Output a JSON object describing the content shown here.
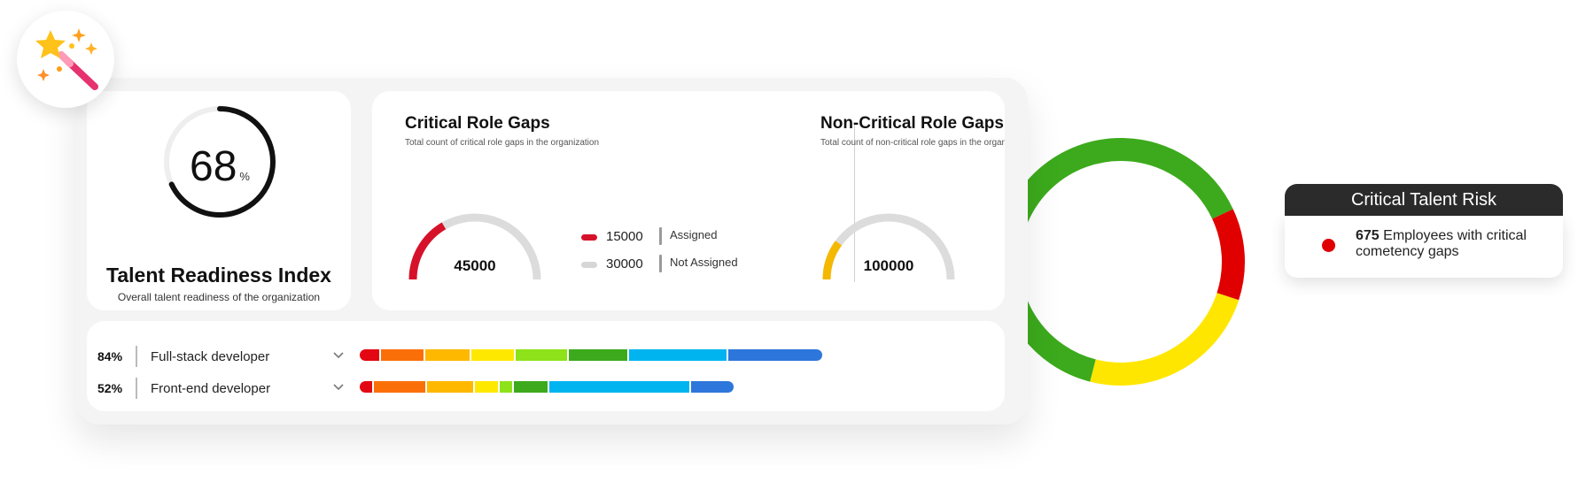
{
  "readiness": {
    "value": "68",
    "unit": "%",
    "fraction": 0.68,
    "title": "Talent Readiness Index",
    "subtitle": "Overall talent readiness of the organization"
  },
  "critical_gaps": {
    "title": "Critical Role Gaps",
    "subtitle": "Total count of critical role gaps in the organization",
    "total": "45000",
    "assigned_fraction": 0.333,
    "color": "#d6122a",
    "legend": [
      {
        "value": "15000",
        "label": "Assigned",
        "color": "#d6122a"
      },
      {
        "value": "30000",
        "label": "Not Assigned",
        "color": "#d6d6d6"
      }
    ]
  },
  "noncritical_gaps": {
    "title": "Non-Critical Role Gaps",
    "subtitle": "Total count of non-critical role gaps in the organization",
    "total": "100000",
    "assigned_fraction": 0.2,
    "color": "#f5b800"
  },
  "roles": [
    {
      "pct": "84%",
      "name": "Full-stack developer",
      "segments": [
        {
          "color": "#e30613",
          "share": 22
        },
        {
          "color": "#fb6f09",
          "share": 48
        },
        {
          "color": "#ffb800",
          "share": 50
        },
        {
          "color": "#ffe800",
          "share": 48
        },
        {
          "color": "#8ee21a",
          "share": 58
        },
        {
          "color": "#3caa1c",
          "share": 66
        },
        {
          "color": "#00b4f0",
          "share": 110
        },
        {
          "color": "#2d76dc",
          "share": 106
        }
      ]
    },
    {
      "pct": "52%",
      "name": "Front-end developer",
      "segments": [
        {
          "color": "#e30613",
          "share": 14
        },
        {
          "color": "#fb6f09",
          "share": 58
        },
        {
          "color": "#ffb800",
          "share": 52
        },
        {
          "color": "#ffe800",
          "share": 26
        },
        {
          "color": "#8ee21a",
          "share": 14
        },
        {
          "color": "#3caa1c",
          "share": 38
        },
        {
          "color": "#00b4f0",
          "share": 158
        },
        {
          "color": "#2d76dc",
          "share": 48
        }
      ]
    }
  ],
  "donut": {
    "segments": [
      {
        "color": "#3caa1c",
        "fraction": 0.18
      },
      {
        "color": "#e00000",
        "fraction": 0.12
      },
      {
        "color": "#ffe600",
        "fraction": 0.24
      },
      {
        "color": "#3caa1c",
        "fraction": 0.46
      }
    ]
  },
  "risk": {
    "title": "Critical Talent Risk",
    "count": "675",
    "text": "Employees with critical cometency gaps",
    "dot_color": "#e00000"
  },
  "icons": {
    "badge": "magic-wand-icon",
    "dropdown": "chevron-down-icon"
  }
}
